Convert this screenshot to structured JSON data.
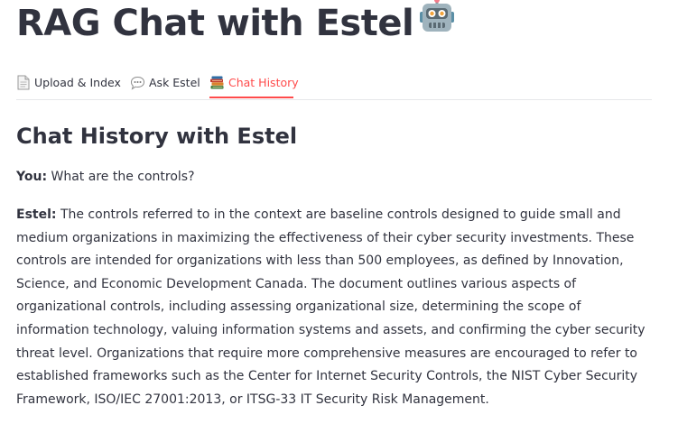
{
  "app": {
    "title": "RAG Chat with Estel"
  },
  "tabs": [
    {
      "label": "Upload & Index",
      "icon": "page-icon",
      "active": false
    },
    {
      "label": "Ask Estel",
      "icon": "speech-bubble-icon",
      "active": false
    },
    {
      "label": "Chat History",
      "icon": "books-icon",
      "active": true
    }
  ],
  "history": {
    "title": "Chat History with Estel",
    "messages": [
      {
        "speaker": "You:",
        "text": "What are the controls?"
      },
      {
        "speaker": "Estel:",
        "text": "The controls referred to in the context are baseline controls designed to guide small and medium organizations in maximizing the effectiveness of their cyber security investments. These controls are intended for organizations with less than 500 employees, as defined by Innovation, Science, and Economic Development Canada. The document outlines various aspects of organizational controls, including assessing organizational size, determining the scope of information technology, valuing information systems and assets, and confirming the cyber security threat level. Organizations that require more comprehensive measures are encouraged to refer to established frameworks such as the Center for Internet Security Controls, the NIST Cyber Security Framework, ISO/IEC 27001:2013, or ITSG-33 IT Security Risk Management."
      }
    ]
  },
  "colors": {
    "accent": "#ff4b4b",
    "text": "#31333f",
    "divider": "#e6e7ea"
  }
}
